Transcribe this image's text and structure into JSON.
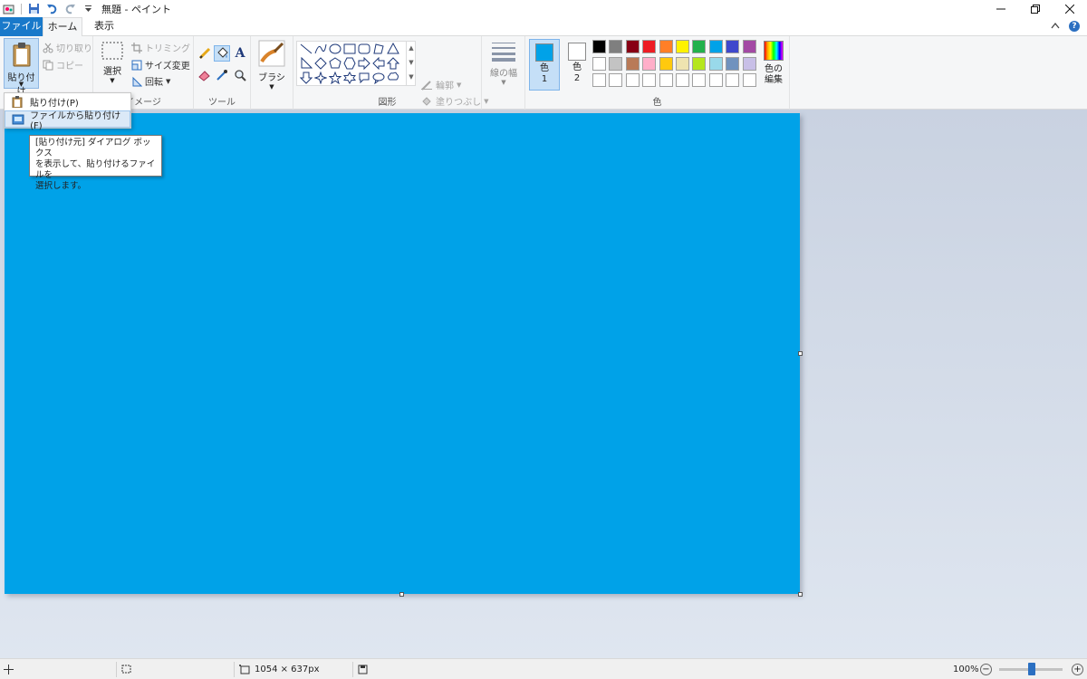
{
  "window": {
    "title": "無題 - ペイント"
  },
  "tabs": {
    "file": "ファイル",
    "home": "ホーム",
    "view": "表示"
  },
  "clipboard": {
    "paste": "貼り付け",
    "cut": "切り取り",
    "copy": "コピー"
  },
  "image_group": {
    "label": "イメージ",
    "select": "選択",
    "crop": "トリミング",
    "resize": "サイズ変更",
    "rotate": "回転"
  },
  "tools_group": {
    "label": "ツール"
  },
  "brushes": {
    "label": "ブラシ"
  },
  "shapes_group": {
    "label": "図形",
    "outline": "輪郭",
    "fill": "塗りつぶし"
  },
  "size": {
    "label": "線の幅"
  },
  "colors_group": {
    "label": "色",
    "color1": "色\n1",
    "color2": "色\n2",
    "color1_value": "#00a2e8",
    "color2_value": "#ffffff",
    "edit_colors": "色の\n編集",
    "palette_row1": [
      "#000000",
      "#7f7f7f",
      "#880015",
      "#ed1c24",
      "#ff7f27",
      "#fff200",
      "#22b14c",
      "#00a2e8",
      "#3f48cc",
      "#a349a4"
    ],
    "palette_row2": [
      "#ffffff",
      "#c3c3c3",
      "#b97a57",
      "#ffaec9",
      "#ffc90e",
      "#efe4b0",
      "#b5e61d",
      "#99d9ea",
      "#7092be",
      "#c8bfe7"
    ],
    "palette_row3": [
      "#ffffff",
      "#ffffff",
      "#ffffff",
      "#ffffff",
      "#ffffff",
      "#ffffff",
      "#ffffff",
      "#ffffff",
      "#ffffff",
      "#ffffff"
    ]
  },
  "paste_menu": {
    "items": [
      {
        "label": "貼り付け(P)",
        "icon": "clipboard-icon"
      },
      {
        "label": "ファイルから貼り付け(F)",
        "icon": "paste-from-file-icon"
      }
    ],
    "tooltip": "[貼り付け元] ダイアログ ボックス\nを表示して、貼り付けるファイルを\n選択します。"
  },
  "canvas": {
    "fill_color": "#00a2e8"
  },
  "status": {
    "dimensions": "1054 × 637px",
    "zoom": "100%"
  }
}
